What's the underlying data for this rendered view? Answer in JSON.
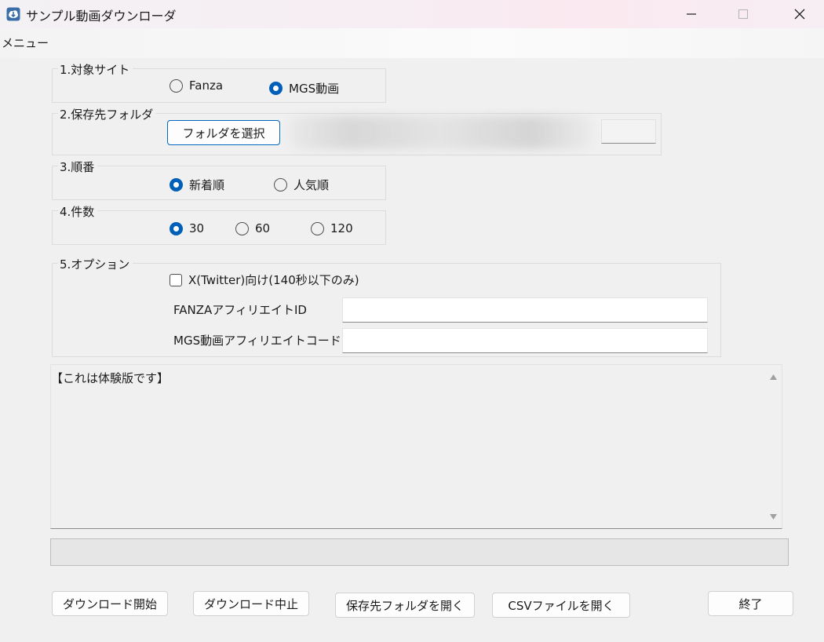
{
  "window": {
    "title": "サンプル動画ダウンローダ",
    "controls": {
      "minimize": "–",
      "maximize": "□",
      "close": "✕"
    }
  },
  "menu": {
    "label": "メニュー"
  },
  "sections": {
    "site": {
      "legend": "1.対象サイト",
      "options": [
        {
          "label": "Fanza",
          "selected": false
        },
        {
          "label": "MGS動画",
          "selected": true
        }
      ]
    },
    "folder": {
      "legend": "2.保存先フォルダ",
      "select_button": "フォルダを選択",
      "path_value": ""
    },
    "order": {
      "legend": "3.順番",
      "options": [
        {
          "label": "新着順",
          "selected": true
        },
        {
          "label": "人気順",
          "selected": false
        }
      ]
    },
    "count": {
      "legend": "4.件数",
      "options": [
        {
          "label": "30",
          "selected": true
        },
        {
          "label": "60",
          "selected": false
        },
        {
          "label": "120",
          "selected": false
        }
      ]
    },
    "options": {
      "legend": "5.オプション",
      "twitter_checkbox": {
        "label": "X(Twitter)向け(140秒以下のみ)",
        "checked": false
      },
      "fanza_affiliate": {
        "label": "FANZAアフィリエイトID",
        "value": ""
      },
      "mgs_affiliate": {
        "label": "MGS動画アフィリエイトコード",
        "value": ""
      }
    }
  },
  "log": {
    "text": "【これは体験版です】"
  },
  "progress": {
    "value": 0
  },
  "buttons": {
    "download_start": "ダウンロード開始",
    "download_stop": "ダウンロード中止",
    "open_folder": "保存先フォルダを開く",
    "open_csv": "CSVファイルを開く",
    "exit": "終了"
  },
  "colors": {
    "accent": "#005fb8",
    "window_bg": "#f0f0f0"
  }
}
